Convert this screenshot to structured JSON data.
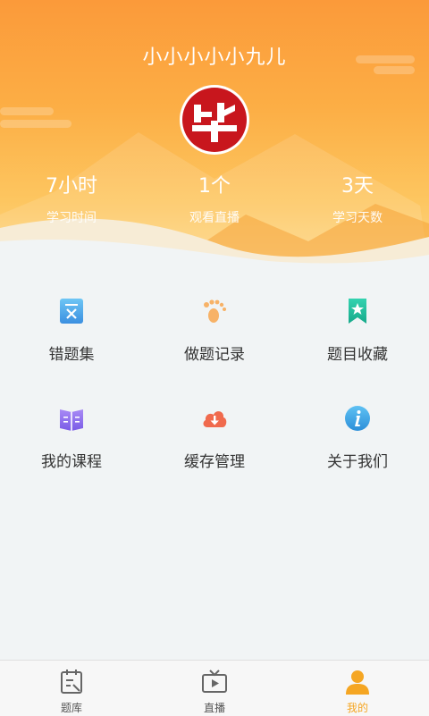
{
  "profile": {
    "username": "小小小小小九儿",
    "stats": [
      {
        "value": "7小时",
        "label": "学习时间"
      },
      {
        "value": "1个",
        "label": "观看直播"
      },
      {
        "value": "3天",
        "label": "学习天数"
      }
    ]
  },
  "menu": [
    {
      "label": "错题集",
      "icon": "mistakes-icon"
    },
    {
      "label": "做题记录",
      "icon": "footprint-icon"
    },
    {
      "label": "题目收藏",
      "icon": "bookmark-icon"
    },
    {
      "label": "我的课程",
      "icon": "book-icon"
    },
    {
      "label": "缓存管理",
      "icon": "cloud-download-icon"
    },
    {
      "label": "关于我们",
      "icon": "info-icon"
    }
  ],
  "tabbar": {
    "items": [
      {
        "label": "题库",
        "icon": "question-bank-icon",
        "active": false
      },
      {
        "label": "直播",
        "icon": "tv-icon",
        "active": false
      },
      {
        "label": "我的",
        "icon": "user-icon",
        "active": true
      }
    ]
  },
  "colors": {
    "header_top": "#fb9a3a",
    "header_bottom": "#fdd889",
    "background": "#f1f4f5",
    "active_tab": "#f5a623",
    "avatar_red": "#c8161d"
  }
}
